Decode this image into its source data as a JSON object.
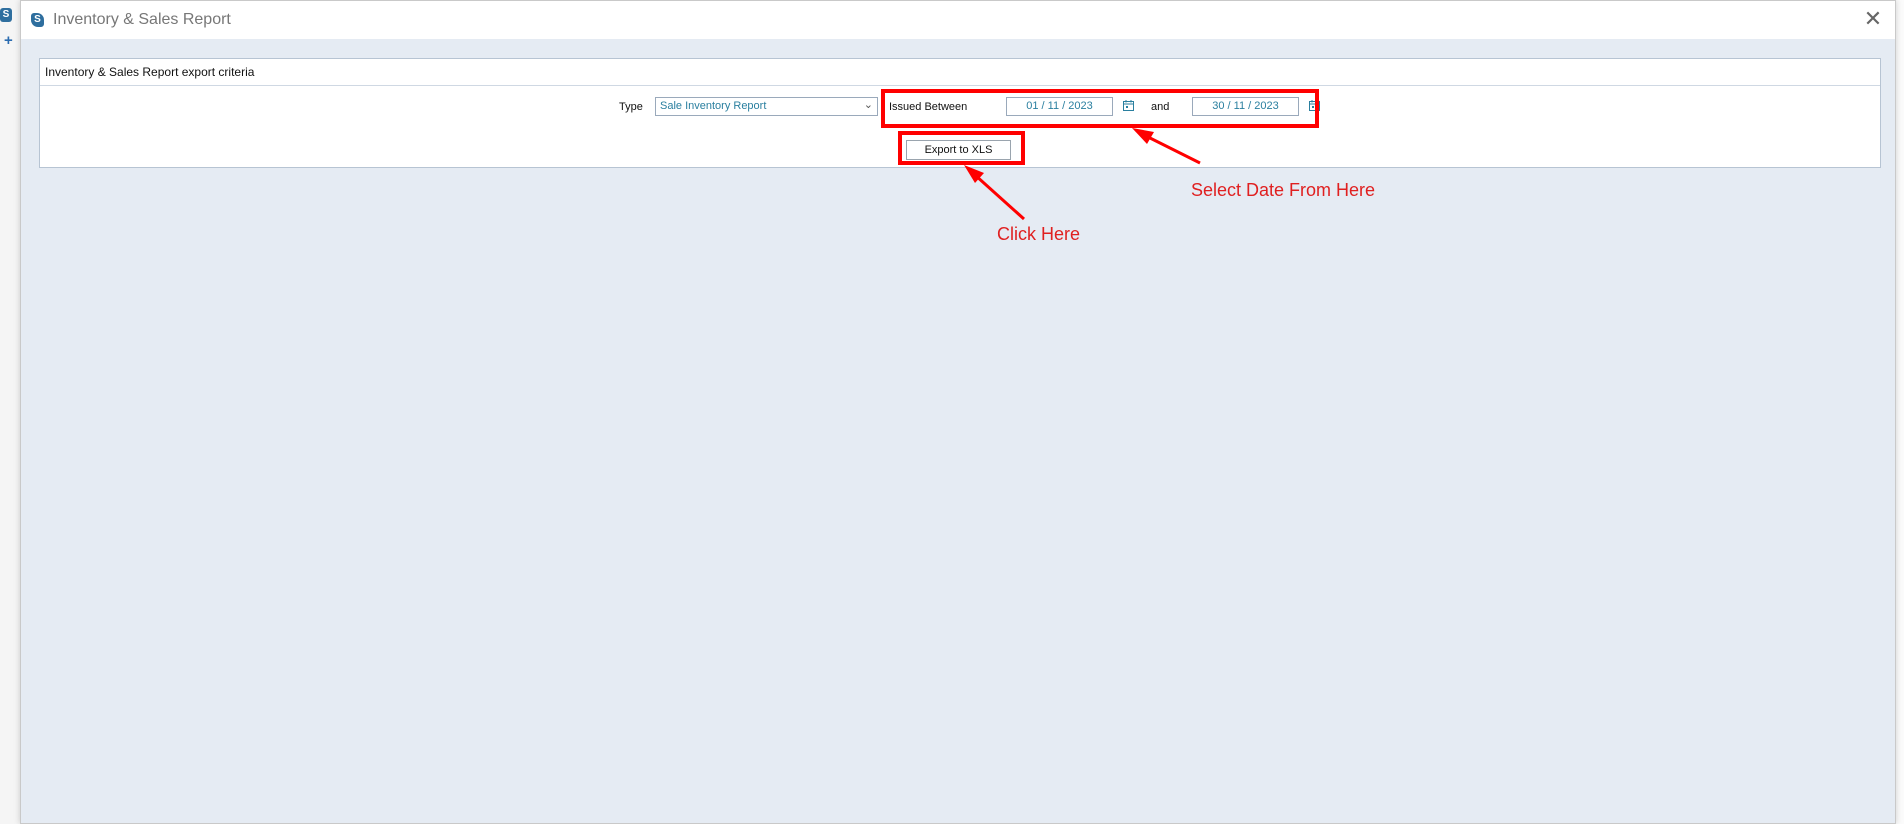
{
  "background_app": {
    "plus_glyph": "+"
  },
  "window": {
    "title": "Inventory & Sales Report",
    "close_glyph": "✕"
  },
  "criteria": {
    "header": "Inventory & Sales Report export criteria",
    "type_label": "Type",
    "type_value": "Sale Inventory Report",
    "issued_between_label": "Issued Between",
    "date_from": "01 / 11 / 2023",
    "and_label": "and",
    "date_to": "30 / 11 / 2023",
    "export_button": "Export to XLS"
  },
  "annotations": {
    "select_date": "Select Date From Here",
    "click_here": "Click Here"
  },
  "colors": {
    "highlight": "#ff0000",
    "annotation_text": "#e02020",
    "content_background": "#e5ebf3",
    "field_text": "#2a7f9f"
  },
  "icons": [
    "app-logo-icon",
    "plus-icon",
    "close-icon",
    "chevron-down-icon",
    "calendar-icon"
  ]
}
